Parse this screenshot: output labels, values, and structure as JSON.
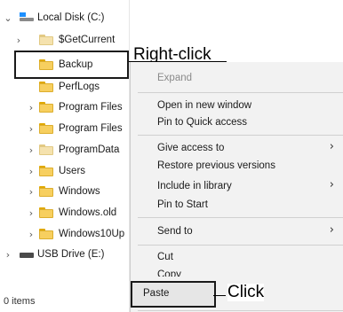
{
  "tree": {
    "local_disk": "Local Disk (C:)",
    "items": [
      {
        "label": "$GetCurrent",
        "chevron": true,
        "pale": true
      },
      {
        "label": "Backup",
        "chevron": false,
        "pale": false
      },
      {
        "label": "PerfLogs",
        "chevron": false,
        "pale": false
      },
      {
        "label": "Program Files",
        "chevron": true,
        "pale": false
      },
      {
        "label": "Program Files",
        "chevron": true,
        "pale": false
      },
      {
        "label": "ProgramData",
        "chevron": true,
        "pale": true
      },
      {
        "label": "Users",
        "chevron": true,
        "pale": false
      },
      {
        "label": "Windows",
        "chevron": true,
        "pale": false
      },
      {
        "label": "Windows.old",
        "chevron": true,
        "pale": false
      },
      {
        "label": "Windows10Up",
        "chevron": true,
        "pale": false
      }
    ],
    "usb_drive": "USB Drive (E:)"
  },
  "status_bar": {
    "items_count": "0 items"
  },
  "callouts": {
    "right_click": "Right-click",
    "click": "Click"
  },
  "context_menu": {
    "expand": "Expand",
    "open_new_window": "Open in new window",
    "pin_quick_access": "Pin to Quick access",
    "give_access": "Give access to",
    "restore_versions": "Restore previous versions",
    "include_library": "Include in library",
    "pin_start": "Pin to Start",
    "send_to": "Send to",
    "cut": "Cut",
    "copy": "Copy",
    "paste": "Paste"
  },
  "icons": {
    "expanded_chevron": "chevron-down-icon",
    "collapsed_chevron": "chevron-right-icon",
    "submenu_arrow": "chevron-right-icon",
    "folder": "folder-icon",
    "drive": "drive-icon"
  },
  "colors": {
    "folder": "#f7cf5f",
    "menu_bg": "#f2f2f2",
    "drive_accent": "#1e90ff"
  }
}
